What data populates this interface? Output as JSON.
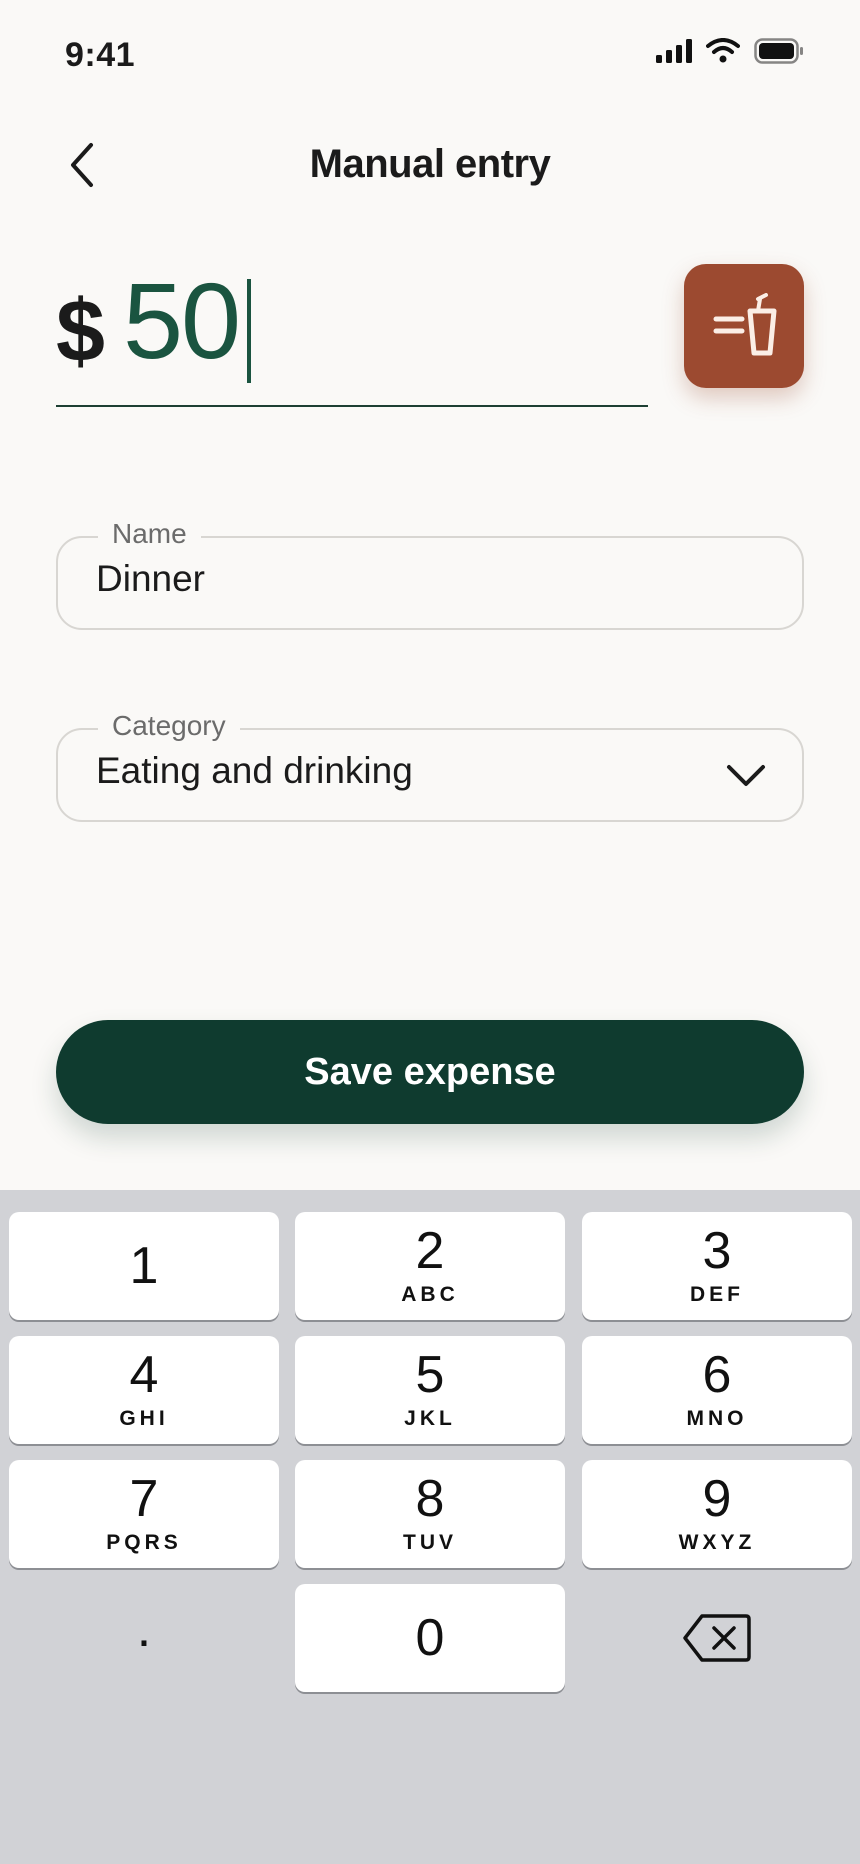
{
  "status_bar": {
    "time": "9:41"
  },
  "header": {
    "title": "Manual entry"
  },
  "amount": {
    "currency": "$",
    "value": "50"
  },
  "category_tile": {
    "icon": "cup-icon",
    "color": "#9c4a30"
  },
  "name_field": {
    "label": "Name",
    "value": "Dinner"
  },
  "category_field": {
    "label": "Category",
    "value": "Eating and drinking"
  },
  "save_button": {
    "label": "Save expense",
    "color": "#0f3b2f"
  },
  "keypad": {
    "keys": [
      {
        "digit": "1",
        "letters": ""
      },
      {
        "digit": "2",
        "letters": "ABC"
      },
      {
        "digit": "3",
        "letters": "DEF"
      },
      {
        "digit": "4",
        "letters": "GHI"
      },
      {
        "digit": "5",
        "letters": "JKL"
      },
      {
        "digit": "6",
        "letters": "MNO"
      },
      {
        "digit": "7",
        "letters": "PQRS"
      },
      {
        "digit": "8",
        "letters": "TUV"
      },
      {
        "digit": "9",
        "letters": "WXYZ"
      },
      {
        "digit": "0",
        "letters": ""
      }
    ],
    "decimal": ".",
    "backspace_icon": "backspace-icon"
  }
}
